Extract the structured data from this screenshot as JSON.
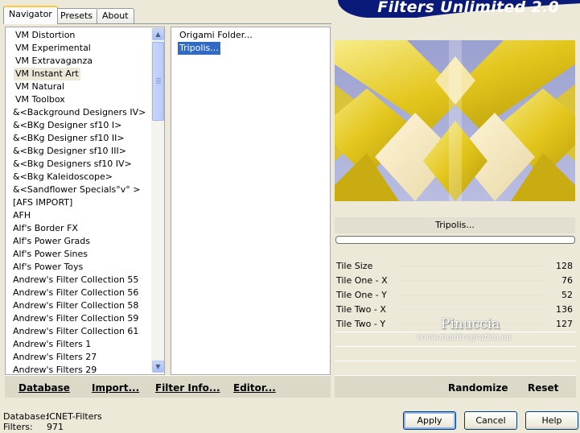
{
  "app": {
    "banner_title": "Filters Unlimited 2.0"
  },
  "tabs": [
    {
      "label": "Navigator",
      "active": true
    },
    {
      "label": "Presets",
      "active": false
    },
    {
      "label": "About",
      "active": false
    }
  ],
  "categories": [
    "VM Distortion",
    "VM Experimental",
    "VM Extravaganza",
    "VM Instant Art",
    "VM Natural",
    "VM Toolbox",
    "&<Background Designers IV>",
    "&<BKg Designer sf10 I>",
    "&<BKg Designer sf10 II>",
    "&<Bkg Designer sf10 III>",
    "&<Bkg Designers sf10 IV>",
    "&<Bkg Kaleidoscope>",
    "&<Sandflower Specials°v° >",
    "[AFS IMPORT]",
    "AFH",
    "Alf's Border FX",
    "Alf's Power Grads",
    "Alf's Power Sines",
    "Alf's Power Toys",
    "Andrew's Filter Collection 55",
    "Andrew's Filter Collection 56",
    "Andrew's Filter Collection 58",
    "Andrew's Filter Collection 59",
    "Andrew's Filter Collection 61",
    "Andrew's Filters 1",
    "Andrew's Filters 27",
    "Andrew's Filters 29"
  ],
  "selected_category_index": 3,
  "filters": [
    "Origami Folder...",
    "Tripolis..."
  ],
  "selected_filter_index": 1,
  "preview": {
    "filter_name": "Tripolis...",
    "watermark_name": "Pinuccia",
    "watermark_url": "www.maidiregrafica.eu"
  },
  "params": [
    {
      "name": "Tile Size",
      "value": 128
    },
    {
      "name": "Tile One - X",
      "value": 76
    },
    {
      "name": "Tile One - Y",
      "value": 52
    },
    {
      "name": "Tile Two - X",
      "value": 136
    },
    {
      "name": "Tile Two - Y",
      "value": 127
    }
  ],
  "toolbar_left": {
    "database": "Database",
    "import": "Import...",
    "filter_info": "Filter Info...",
    "editor": "Editor..."
  },
  "toolbar_right": {
    "randomize": "Randomize",
    "reset": "Reset"
  },
  "status": {
    "database_label": "Database:",
    "database_value": "ICNET-Filters",
    "filters_label": "Filters:",
    "filters_value": "971"
  },
  "buttons": {
    "apply": "Apply",
    "cancel": "Cancel",
    "help": "Help"
  },
  "colors": {
    "selection": "#316ac5",
    "banner": "#0a1a78",
    "tab_accent": "#ffc83c"
  },
  "icons": {
    "scroll_up": "scroll-up-arrow-icon",
    "scroll_down": "scroll-down-arrow-icon"
  }
}
